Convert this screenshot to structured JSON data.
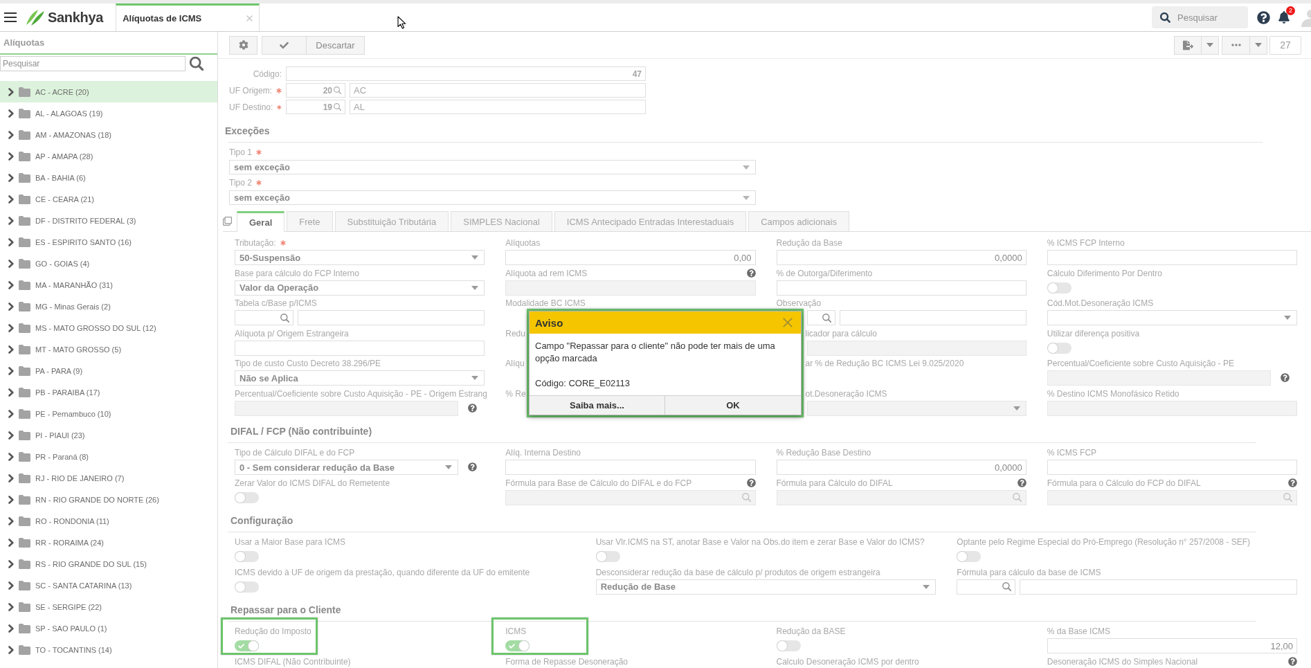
{
  "topbar": {
    "brand": "Sankhya",
    "open_tab": "Alíquotas de ICMS",
    "search": {
      "placeholder": "Pesquisar"
    },
    "notification_count": "2"
  },
  "sidebar": {
    "title": "Alíquotas",
    "search": {
      "placeholder": "Pesquisar"
    },
    "items": [
      {
        "label": "AC - ACRE (20)",
        "selected": true,
        "expanded": false
      },
      {
        "label": "AL - ALAGOAS (19)",
        "selected": false,
        "expanded": false
      },
      {
        "label": "AM - AMAZONAS (18)",
        "selected": false,
        "expanded": false
      },
      {
        "label": "AP - AMAPA (28)",
        "selected": false,
        "expanded": false
      },
      {
        "label": "BA - BAHIA (6)",
        "selected": false,
        "expanded": false
      },
      {
        "label": "CE - CEARA (21)",
        "selected": false,
        "expanded": false
      },
      {
        "label": "DF - DISTRITO FEDERAL (3)",
        "selected": false,
        "expanded": false
      },
      {
        "label": "ES - ESPIRITO SANTO (16)",
        "selected": false,
        "expanded": false
      },
      {
        "label": "GO - GOIAS (4)",
        "selected": false,
        "expanded": false
      },
      {
        "label": "MA - MARANHÃO (31)",
        "selected": false,
        "expanded": false
      },
      {
        "label": "MG - Minas Gerais (2)",
        "selected": false,
        "expanded": false
      },
      {
        "label": "MS - MATO GROSSO DO SUL (12)",
        "selected": false,
        "expanded": false
      },
      {
        "label": "MT - MATO GROSSO (5)",
        "selected": false,
        "expanded": false
      },
      {
        "label": "PA - PARA (9)",
        "selected": false,
        "expanded": false
      },
      {
        "label": "PB - PARAIBA (17)",
        "selected": false,
        "expanded": false
      },
      {
        "label": "PE - Pernambuco (10)",
        "selected": false,
        "expanded": false
      },
      {
        "label": "PI - PIAUI (23)",
        "selected": false,
        "expanded": false
      },
      {
        "label": "PR - Paraná (8)",
        "selected": false,
        "expanded": false
      },
      {
        "label": "RJ - RIO DE JANEIRO (7)",
        "selected": false,
        "expanded": false
      },
      {
        "label": "RN - RIO GRANDE DO NORTE (26)",
        "selected": false,
        "expanded": false
      },
      {
        "label": "RO - RONDONIA (11)",
        "selected": false,
        "expanded": false
      },
      {
        "label": "RR - RORAIMA (24)",
        "selected": false,
        "expanded": false
      },
      {
        "label": "RS - RIO GRANDE DO SUL (15)",
        "selected": false,
        "expanded": false
      },
      {
        "label": "SC - SANTA CATARINA (13)",
        "selected": false,
        "expanded": false
      },
      {
        "label": "SE - SERGIPE (22)",
        "selected": false,
        "expanded": false
      },
      {
        "label": "SP - SAO PAULO (1)",
        "selected": false,
        "expanded": false
      },
      {
        "label": "TO - TOCANTINS (14)",
        "selected": false,
        "expanded": false
      }
    ]
  },
  "toolbar": {
    "discard": "Descartar",
    "record_count": "27"
  },
  "record": {
    "fields": [
      {
        "label": "Código:",
        "required": false,
        "kind": "input",
        "value": "47"
      },
      {
        "label": "UF Origem:",
        "required": true,
        "kind": "lookup",
        "code": "20",
        "value": "AC"
      },
      {
        "label": "UF Destino:",
        "required": true,
        "kind": "lookup",
        "code": "19",
        "value": "AL"
      }
    ]
  },
  "exceptions": {
    "title": "Exceções",
    "fields": [
      {
        "label": "Tipo 1",
        "required": true,
        "value": "sem exceção"
      },
      {
        "label": "Tipo 2",
        "required": true,
        "value": "sem exceção"
      }
    ]
  },
  "tabs": [
    {
      "label": "Geral",
      "selected": true
    },
    {
      "label": "Frete",
      "selected": false
    },
    {
      "label": "Substituição Tributária",
      "selected": false
    },
    {
      "label": "SIMPLES Nacional",
      "selected": false
    },
    {
      "label": "ICMS Antecipado Entradas Interestaduais",
      "selected": false
    },
    {
      "label": "Campos adicionais",
      "selected": false
    }
  ],
  "sections": [
    {
      "columns": [
        {
          "fields": [
            {
              "label": "Tributação:",
              "required": true,
              "kind": "select",
              "value": "50-Suspensão",
              "disabled": false
            },
            {
              "label": "Base para cálculo do FCP Interno",
              "required": false,
              "kind": "select",
              "value": "Valor da Operação",
              "disabled": false
            },
            {
              "label": "Tabela c/Base p/ICMS",
              "required": false,
              "kind": "lookup",
              "disabled": false
            },
            {
              "label": "Alíquota p/ Origem Estrangeira",
              "required": false,
              "kind": "input",
              "disabled": false
            },
            {
              "label": "Tipo de custo Custo Decreto 38.296/PE",
              "required": false,
              "kind": "select",
              "value": "Não se Aplica",
              "disabled": false
            },
            {
              "label": "Percentual/Coeficiente sobre Custo Aquisição - PE - Origem Estrang",
              "required": false,
              "kind": "input",
              "disabled": true,
              "control_help": true
            }
          ]
        },
        {
          "fields": [
            {
              "label": "Alíquotas",
              "required": false,
              "kind": "input",
              "value": "0,00",
              "disabled": false
            },
            {
              "label": "Alíquota ad rem ICMS",
              "required": false,
              "kind": "input",
              "disabled": true,
              "help": true
            },
            {
              "label": "Modalidade BC ICMS",
              "required": false,
              "kind": "label"
            },
            {
              "label": "Redu",
              "required": false,
              "kind": "label"
            },
            {
              "label": "Alíqu",
              "required": false,
              "kind": "label"
            },
            {
              "label": "% Re",
              "required": false,
              "kind": "label"
            }
          ]
        },
        {
          "fields": [
            {
              "label": "Redução da Base",
              "required": false,
              "kind": "input",
              "value": "0,0000",
              "disabled": false
            },
            {
              "label": "% de Outorga/Diferimento",
              "required": false,
              "kind": "input",
              "disabled": false
            },
            {
              "label": "Observação",
              "required": false,
              "kind": "lookup",
              "disabled": false,
              "control_covered": true
            },
            {
              "label": "licador para cálculo",
              "required": false,
              "kind": "input",
              "disabled": true,
              "label_covered": true,
              "control_covered": true
            },
            {
              "label": "ar % de Redução BC ICMS Lei 9.025/2020",
              "required": false,
              "kind": "label",
              "label_covered": true
            },
            {
              "label": "ot.Desoneração ICMS",
              "required": false,
              "kind": "select",
              "disabled": true,
              "label_covered": true,
              "control_covered": true
            }
          ]
        },
        {
          "fields": [
            {
              "label": "% ICMS FCP Interno",
              "required": false,
              "kind": "input",
              "disabled": false
            },
            {
              "label": "Cálculo Diferimento Por Dentro",
              "required": false,
              "kind": "toggle",
              "on": false
            },
            {
              "label": "Cód.Mot.Desoneração ICMS",
              "required": false,
              "kind": "select",
              "disabled": false
            },
            {
              "label": "Utilizar diferença positiva",
              "required": false,
              "kind": "toggle",
              "on": false
            },
            {
              "label": "Percentual/Coeficiente sobre Custo Aquisição - PE",
              "required": false,
              "kind": "input",
              "disabled": true,
              "control_help": true
            },
            {
              "label": "% Destino ICMS Monofásico Retido",
              "required": false,
              "kind": "input",
              "disabled": true
            }
          ]
        }
      ]
    },
    {
      "title": "DIFAL / FCP (Não contribuinte)",
      "columns": [
        {
          "fields": [
            {
              "label": "Tipo de Cálculo DIFAL e do FCP",
              "required": false,
              "kind": "select",
              "value": "0 - Sem considerar redução da Base",
              "disabled": false,
              "control_help": true
            },
            {
              "label": "Zerar Valor do ICMS DIFAL do Remetente",
              "required": false,
              "kind": "toggle",
              "on": false
            }
          ]
        },
        {
          "fields": [
            {
              "label": "Alíq. Interna Destino",
              "required": false,
              "kind": "input",
              "disabled": false
            },
            {
              "label": "Fórmula para Base de Cálculo do DIFAL e do FCP",
              "required": false,
              "kind": "search",
              "disabled": true,
              "help": true
            }
          ]
        },
        {
          "fields": [
            {
              "label": "% Redução Base Destino",
              "required": false,
              "kind": "input",
              "value": "0,0000",
              "disabled": false
            },
            {
              "label": "Fórmula para Cálculo do DIFAL",
              "required": false,
              "kind": "search",
              "disabled": true,
              "help": true
            }
          ]
        },
        {
          "fields": [
            {
              "label": "% ICMS FCP",
              "required": false,
              "kind": "input",
              "disabled": false
            },
            {
              "label": "Fórmula para o Cálculo do FCP do DIFAL",
              "required": false,
              "kind": "search",
              "disabled": true,
              "help": true
            }
          ]
        }
      ]
    },
    {
      "title": "Configuração",
      "columns": [
        {
          "fields": [
            {
              "label": "Usar a Maior Base para ICMS",
              "required": false,
              "kind": "toggle",
              "on": false
            },
            {
              "label": "ICMS devido à UF de origem da prestação, quando diferente da UF do emitente",
              "required": false,
              "kind": "toggle",
              "on": false
            }
          ]
        },
        {
          "fields": [
            {
              "label": "Usar Vlr.ICMS na ST, anotar Base e Valor na Obs.do item e zerar Base e Valor do ICMS?",
              "required": false,
              "kind": "toggle",
              "on": false
            },
            {
              "label": "Desconsiderar redução da base de cálculo p/ produtos de origem estrangeira",
              "required": false,
              "kind": "select",
              "value": "Redução de Base",
              "disabled": false
            }
          ]
        },
        {
          "fields": [
            {
              "label": "Optante pelo Regime Especial do Pró-Emprego (Resolução n° 257/2008 - SEF)",
              "required": false,
              "kind": "toggle",
              "on": false
            },
            {
              "label": "Fórmula para cálculo da base de ICMS",
              "required": false,
              "kind": "lookup",
              "disabled": false
            }
          ]
        }
      ]
    },
    {
      "title": "Repassar para o Cliente",
      "columns": [
        {
          "fields": [
            {
              "label": "Redução do Imposto",
              "required": false,
              "kind": "toggle",
              "on": true,
              "highlighted": true
            },
            {
              "label": "ICMS DIFAL (Não Contribuinte)",
              "required": false,
              "kind": "label",
              "highlighted": false
            }
          ]
        },
        {
          "fields": [
            {
              "label": "ICMS",
              "required": false,
              "kind": "toggle",
              "on": true,
              "highlighted": true
            },
            {
              "label": "Forma de Repasse Desoneração",
              "required": false,
              "kind": "label",
              "highlighted": false
            }
          ]
        },
        {
          "fields": [
            {
              "label": "Redução da BASE",
              "required": false,
              "kind": "toggle",
              "on": false,
              "highlighted": false
            },
            {
              "label": "Calculo Desoneração ICMS por dentro",
              "required": false,
              "kind": "label",
              "highlighted": false
            }
          ]
        },
        {
          "fields": [
            {
              "label": "% da Base ICMS",
              "required": false,
              "kind": "input",
              "value": "12,00",
              "disabled": false,
              "highlighted": false
            },
            {
              "label": "Desoneração ICMS do Simples Nacional",
              "required": false,
              "kind": "label",
              "help": true,
              "highlighted": false
            }
          ]
        }
      ]
    }
  ],
  "dialog": {
    "title": "Aviso",
    "message": "Campo \"Repassar para o cliente\" não pode ter mais de uma opção marcada",
    "code": "Código: CORE_E02113",
    "buttons": [
      "Saiba mais...",
      "OK"
    ],
    "highlighted": true
  }
}
